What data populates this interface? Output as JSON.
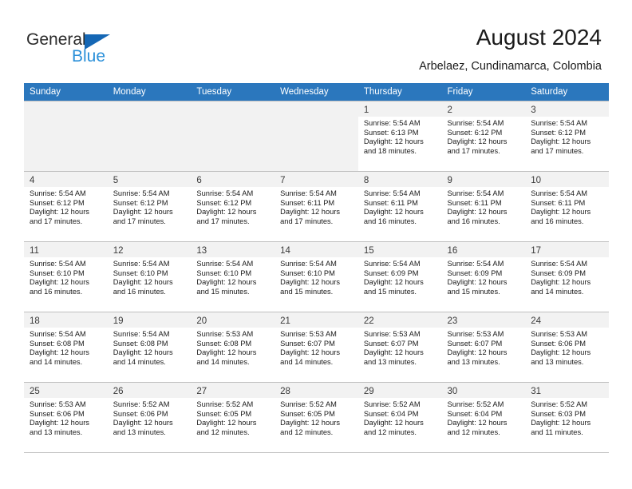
{
  "brand": {
    "name_part1": "General",
    "name_part2": "Blue",
    "accent_color": "#2b90d9",
    "triangle_color": "#1567b5"
  },
  "header": {
    "title": "August 2024",
    "subtitle": "Arbelaez, Cundinamarca, Colombia"
  },
  "calendar": {
    "header_bg": "#2b77bd",
    "weekday_headers": [
      "Sunday",
      "Monday",
      "Tuesday",
      "Wednesday",
      "Thursday",
      "Friday",
      "Saturday"
    ],
    "weeks": [
      [
        {
          "day": "",
          "lines": []
        },
        {
          "day": "",
          "lines": []
        },
        {
          "day": "",
          "lines": []
        },
        {
          "day": "",
          "lines": []
        },
        {
          "day": "1",
          "lines": [
            "Sunrise: 5:54 AM",
            "Sunset: 6:13 PM",
            "Daylight: 12 hours",
            "and 18 minutes."
          ]
        },
        {
          "day": "2",
          "lines": [
            "Sunrise: 5:54 AM",
            "Sunset: 6:12 PM",
            "Daylight: 12 hours",
            "and 17 minutes."
          ]
        },
        {
          "day": "3",
          "lines": [
            "Sunrise: 5:54 AM",
            "Sunset: 6:12 PM",
            "Daylight: 12 hours",
            "and 17 minutes."
          ]
        }
      ],
      [
        {
          "day": "4",
          "lines": [
            "Sunrise: 5:54 AM",
            "Sunset: 6:12 PM",
            "Daylight: 12 hours",
            "and 17 minutes."
          ]
        },
        {
          "day": "5",
          "lines": [
            "Sunrise: 5:54 AM",
            "Sunset: 6:12 PM",
            "Daylight: 12 hours",
            "and 17 minutes."
          ]
        },
        {
          "day": "6",
          "lines": [
            "Sunrise: 5:54 AM",
            "Sunset: 6:12 PM",
            "Daylight: 12 hours",
            "and 17 minutes."
          ]
        },
        {
          "day": "7",
          "lines": [
            "Sunrise: 5:54 AM",
            "Sunset: 6:11 PM",
            "Daylight: 12 hours",
            "and 17 minutes."
          ]
        },
        {
          "day": "8",
          "lines": [
            "Sunrise: 5:54 AM",
            "Sunset: 6:11 PM",
            "Daylight: 12 hours",
            "and 16 minutes."
          ]
        },
        {
          "day": "9",
          "lines": [
            "Sunrise: 5:54 AM",
            "Sunset: 6:11 PM",
            "Daylight: 12 hours",
            "and 16 minutes."
          ]
        },
        {
          "day": "10",
          "lines": [
            "Sunrise: 5:54 AM",
            "Sunset: 6:11 PM",
            "Daylight: 12 hours",
            "and 16 minutes."
          ]
        }
      ],
      [
        {
          "day": "11",
          "lines": [
            "Sunrise: 5:54 AM",
            "Sunset: 6:10 PM",
            "Daylight: 12 hours",
            "and 16 minutes."
          ]
        },
        {
          "day": "12",
          "lines": [
            "Sunrise: 5:54 AM",
            "Sunset: 6:10 PM",
            "Daylight: 12 hours",
            "and 16 minutes."
          ]
        },
        {
          "day": "13",
          "lines": [
            "Sunrise: 5:54 AM",
            "Sunset: 6:10 PM",
            "Daylight: 12 hours",
            "and 15 minutes."
          ]
        },
        {
          "day": "14",
          "lines": [
            "Sunrise: 5:54 AM",
            "Sunset: 6:10 PM",
            "Daylight: 12 hours",
            "and 15 minutes."
          ]
        },
        {
          "day": "15",
          "lines": [
            "Sunrise: 5:54 AM",
            "Sunset: 6:09 PM",
            "Daylight: 12 hours",
            "and 15 minutes."
          ]
        },
        {
          "day": "16",
          "lines": [
            "Sunrise: 5:54 AM",
            "Sunset: 6:09 PM",
            "Daylight: 12 hours",
            "and 15 minutes."
          ]
        },
        {
          "day": "17",
          "lines": [
            "Sunrise: 5:54 AM",
            "Sunset: 6:09 PM",
            "Daylight: 12 hours",
            "and 14 minutes."
          ]
        }
      ],
      [
        {
          "day": "18",
          "lines": [
            "Sunrise: 5:54 AM",
            "Sunset: 6:08 PM",
            "Daylight: 12 hours",
            "and 14 minutes."
          ]
        },
        {
          "day": "19",
          "lines": [
            "Sunrise: 5:54 AM",
            "Sunset: 6:08 PM",
            "Daylight: 12 hours",
            "and 14 minutes."
          ]
        },
        {
          "day": "20",
          "lines": [
            "Sunrise: 5:53 AM",
            "Sunset: 6:08 PM",
            "Daylight: 12 hours",
            "and 14 minutes."
          ]
        },
        {
          "day": "21",
          "lines": [
            "Sunrise: 5:53 AM",
            "Sunset: 6:07 PM",
            "Daylight: 12 hours",
            "and 14 minutes."
          ]
        },
        {
          "day": "22",
          "lines": [
            "Sunrise: 5:53 AM",
            "Sunset: 6:07 PM",
            "Daylight: 12 hours",
            "and 13 minutes."
          ]
        },
        {
          "day": "23",
          "lines": [
            "Sunrise: 5:53 AM",
            "Sunset: 6:07 PM",
            "Daylight: 12 hours",
            "and 13 minutes."
          ]
        },
        {
          "day": "24",
          "lines": [
            "Sunrise: 5:53 AM",
            "Sunset: 6:06 PM",
            "Daylight: 12 hours",
            "and 13 minutes."
          ]
        }
      ],
      [
        {
          "day": "25",
          "lines": [
            "Sunrise: 5:53 AM",
            "Sunset: 6:06 PM",
            "Daylight: 12 hours",
            "and 13 minutes."
          ]
        },
        {
          "day": "26",
          "lines": [
            "Sunrise: 5:52 AM",
            "Sunset: 6:06 PM",
            "Daylight: 12 hours",
            "and 13 minutes."
          ]
        },
        {
          "day": "27",
          "lines": [
            "Sunrise: 5:52 AM",
            "Sunset: 6:05 PM",
            "Daylight: 12 hours",
            "and 12 minutes."
          ]
        },
        {
          "day": "28",
          "lines": [
            "Sunrise: 5:52 AM",
            "Sunset: 6:05 PM",
            "Daylight: 12 hours",
            "and 12 minutes."
          ]
        },
        {
          "day": "29",
          "lines": [
            "Sunrise: 5:52 AM",
            "Sunset: 6:04 PM",
            "Daylight: 12 hours",
            "and 12 minutes."
          ]
        },
        {
          "day": "30",
          "lines": [
            "Sunrise: 5:52 AM",
            "Sunset: 6:04 PM",
            "Daylight: 12 hours",
            "and 12 minutes."
          ]
        },
        {
          "day": "31",
          "lines": [
            "Sunrise: 5:52 AM",
            "Sunset: 6:03 PM",
            "Daylight: 12 hours",
            "and 11 minutes."
          ]
        }
      ]
    ]
  }
}
